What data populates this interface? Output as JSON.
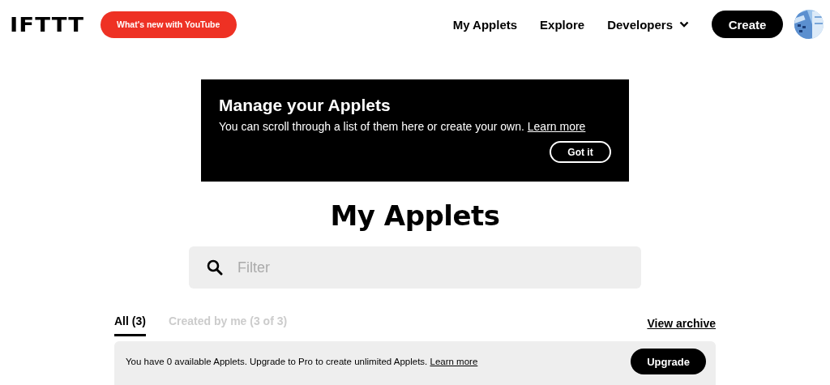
{
  "header": {
    "logo": "IFTTT",
    "promo": "What's new with YouTube",
    "nav": [
      {
        "label": "My Applets",
        "kind": "link"
      },
      {
        "label": "Explore",
        "kind": "link"
      },
      {
        "label": "Developers",
        "kind": "dropdown"
      }
    ],
    "create": "Create"
  },
  "banner": {
    "title": "Manage your Applets",
    "text": "You can scroll through a list of them here or create your own.",
    "link": "Learn more",
    "button": "Got it"
  },
  "title": "My Applets",
  "search": {
    "placeholder": "Filter"
  },
  "tabs": [
    {
      "label": "All (3)",
      "selected": true
    },
    {
      "label": "Created by me (3 of 3)",
      "selected": false
    }
  ],
  "archive": "View archive",
  "upgrade_bar": {
    "text": "You have 0 available Applets. Upgrade to Pro to create unlimited Applets.",
    "link": "Learn more",
    "button": "Upgrade"
  }
}
